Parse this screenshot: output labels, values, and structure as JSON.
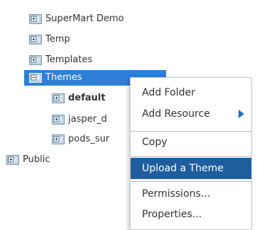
{
  "tree": {
    "nodes": [
      {
        "label": "SuperMart Demo",
        "bold": false,
        "selected": false
      },
      {
        "label": "Temp",
        "bold": false,
        "selected": false
      },
      {
        "label": "Templates",
        "bold": false,
        "selected": false
      },
      {
        "label": "Themes",
        "bold": false,
        "selected": true
      },
      {
        "label": "default",
        "bold": true,
        "selected": false
      },
      {
        "label": "jasper_d",
        "bold": false,
        "selected": false
      },
      {
        "label": "pods_sur",
        "bold": false,
        "selected": false
      },
      {
        "label": "Public",
        "bold": false,
        "selected": false
      }
    ]
  },
  "context_menu": {
    "items": [
      {
        "label": "Add Folder",
        "submenu": false,
        "highlighted": false
      },
      {
        "label": "Add Resource",
        "submenu": true,
        "highlighted": false
      },
      {
        "label": "Copy",
        "submenu": false,
        "highlighted": false
      },
      {
        "label": "Upload a Theme",
        "submenu": false,
        "highlighted": true
      },
      {
        "label": "Permissions...",
        "submenu": false,
        "highlighted": false
      },
      {
        "label": "Properties...",
        "submenu": false,
        "highlighted": false
      }
    ]
  },
  "colors": {
    "selection": "#2e7fd6",
    "menu_highlight": "#1f5e9e",
    "submenu_arrow": "#1f6fc7"
  },
  "icons": {
    "collapsed_folder": "folder-expand-icon",
    "expanded_folder": "folder-collapse-icon",
    "submenu_arrow": "triangle-right-icon"
  }
}
